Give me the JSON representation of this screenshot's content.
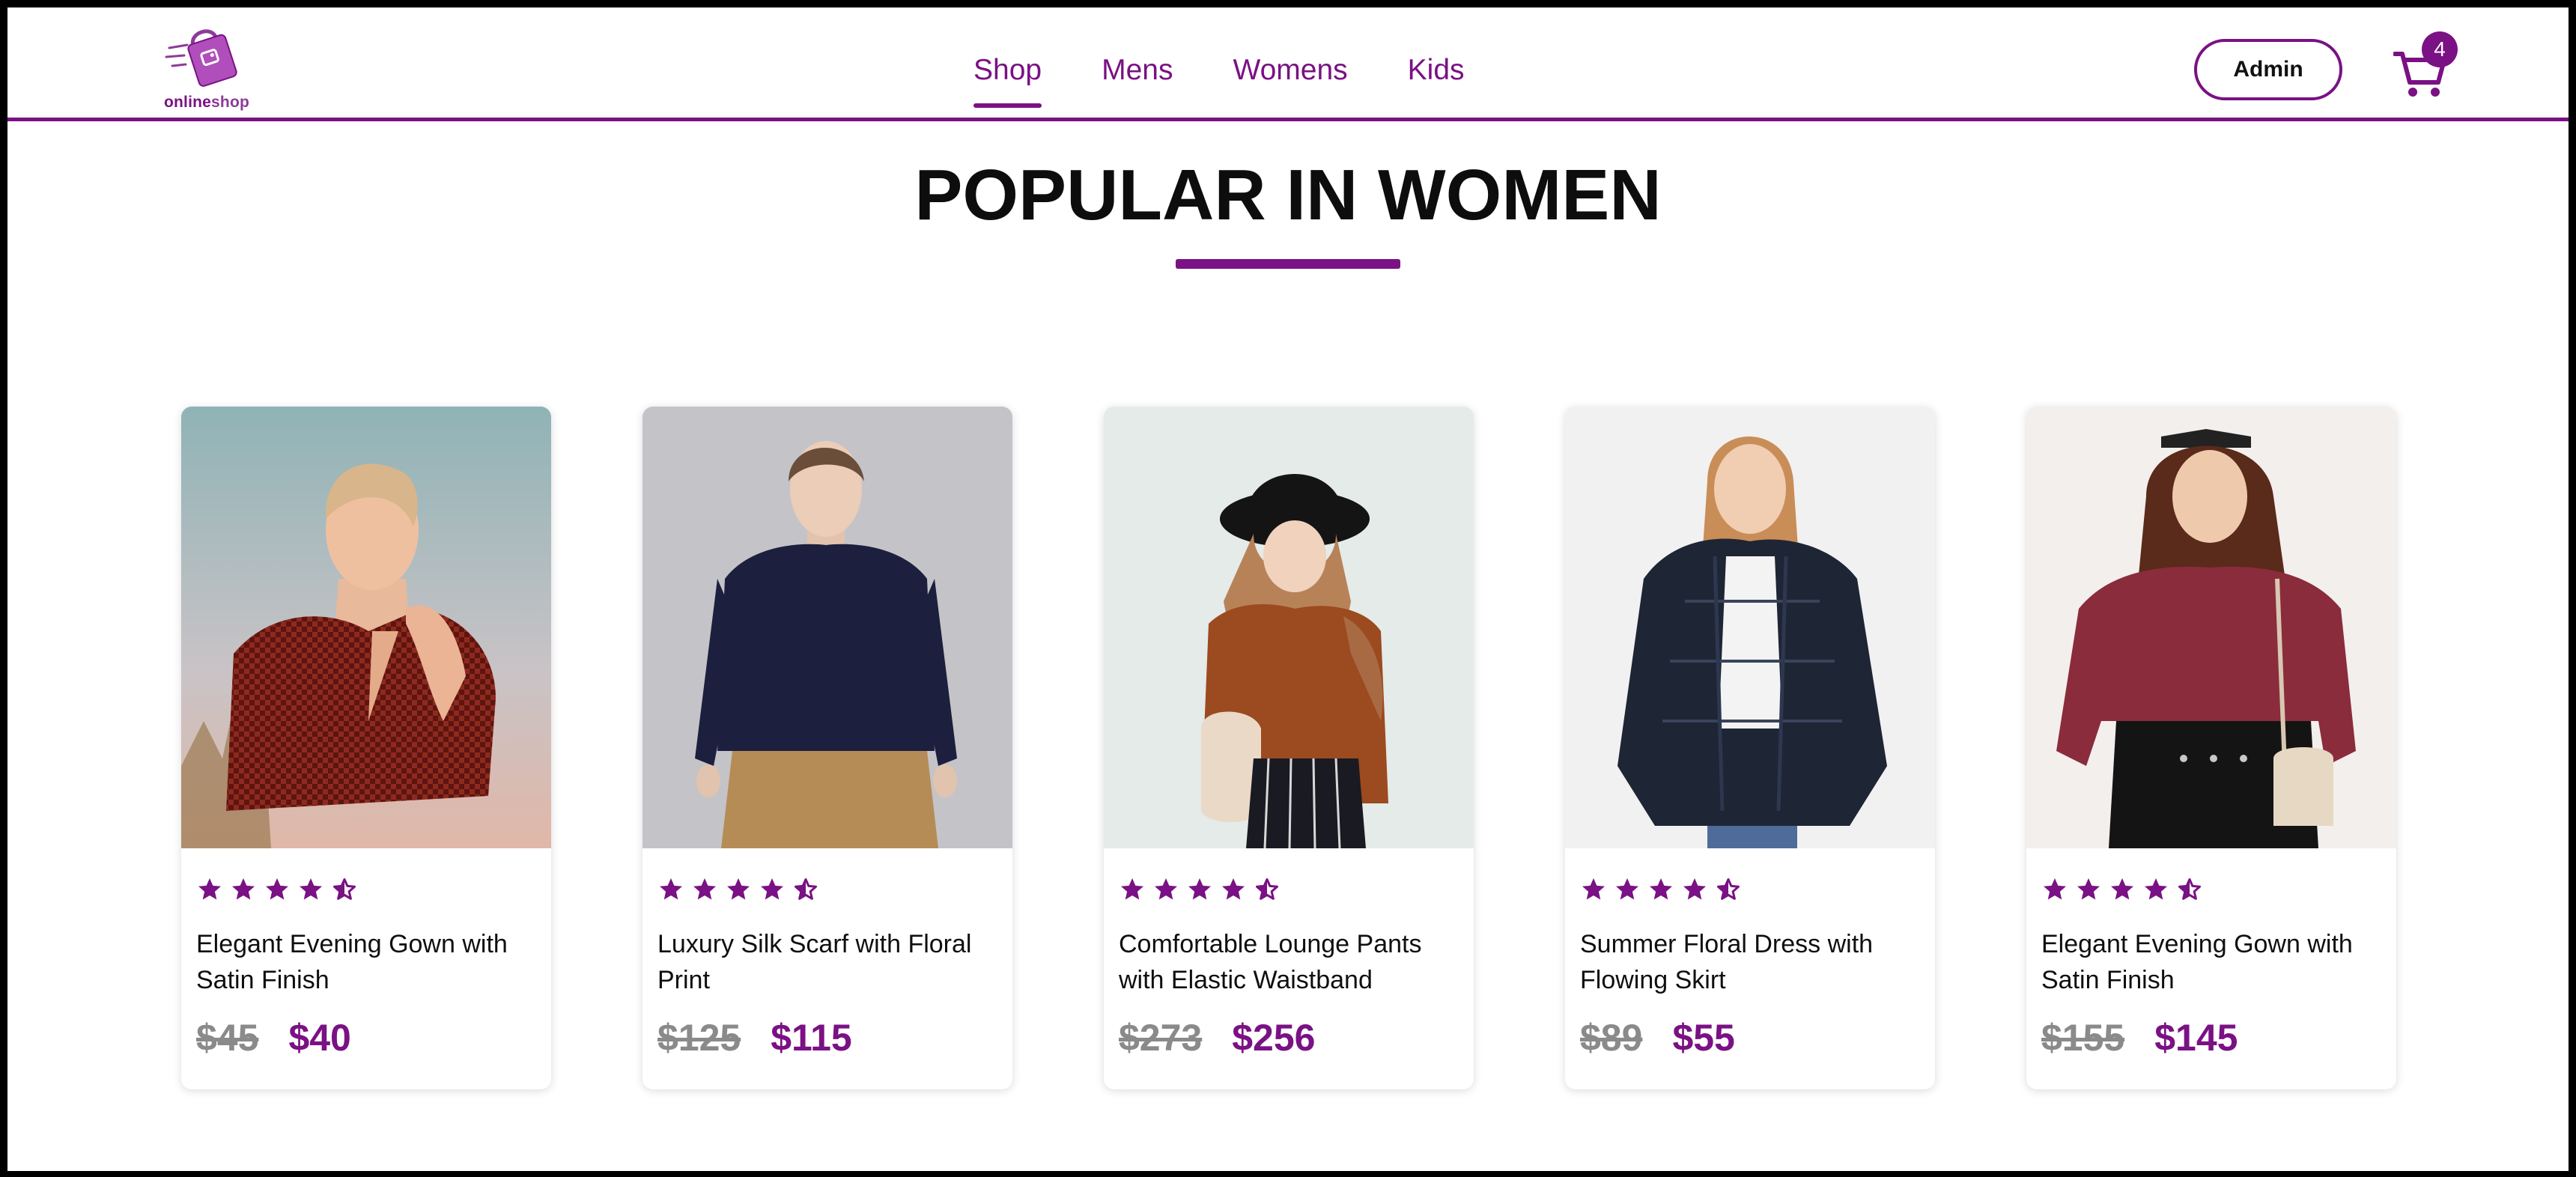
{
  "brand": {
    "part1": "online",
    "part2": "shop"
  },
  "nav": {
    "items": [
      {
        "label": "Shop",
        "active": true
      },
      {
        "label": "Mens",
        "active": false
      },
      {
        "label": "Womens",
        "active": false
      },
      {
        "label": "Kids",
        "active": false
      }
    ],
    "admin_label": "Admin",
    "cart_count": "4"
  },
  "section": {
    "title": "POPULAR IN WOMEN"
  },
  "products": [
    {
      "name": "Elegant Evening Gown with Satin Finish",
      "old_price": "$45",
      "new_price": "$40",
      "rating": 4.5
    },
    {
      "name": "Luxury Silk Scarf with Floral Print",
      "old_price": "$125",
      "new_price": "$115",
      "rating": 4.5
    },
    {
      "name": "Comfortable Lounge Pants with Elastic Waistband",
      "old_price": "$273",
      "new_price": "$256",
      "rating": 4.5
    },
    {
      "name": "Summer Floral Dress with Flowing Skirt",
      "old_price": "$89",
      "new_price": "$55",
      "rating": 4.5
    },
    {
      "name": "Elegant Evening Gown with Satin Finish",
      "old_price": "$155",
      "new_price": "$145",
      "rating": 4.5
    }
  ],
  "colors": {
    "accent": "#7a1184",
    "old_price": "#8a8a8a",
    "text": "#0f0f0f"
  },
  "icons": {
    "logo": "shopping-bag-icon",
    "cart": "cart-icon",
    "star": "star-icon",
    "half_star": "half-star-icon"
  }
}
